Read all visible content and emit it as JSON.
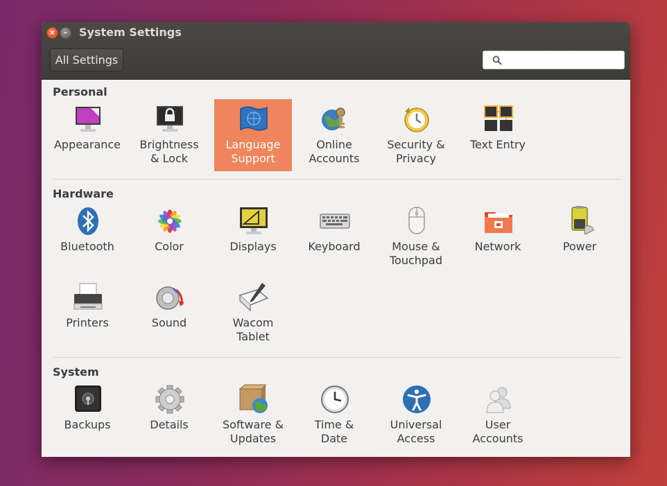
{
  "window": {
    "title": "System Settings"
  },
  "toolbar": {
    "all_settings_label": "All Settings",
    "search_placeholder": ""
  },
  "sections": [
    {
      "title": "Personal",
      "items": [
        {
          "label": "Appearance",
          "icon": "appearance-icon"
        },
        {
          "label": "Brightness\n& Lock",
          "icon": "lock-icon"
        },
        {
          "label": "Language\nSupport",
          "icon": "language-flag-icon",
          "selected": true
        },
        {
          "label": "Online\nAccounts",
          "icon": "online-accounts-icon"
        },
        {
          "label": "Security &\nPrivacy",
          "icon": "security-privacy-icon"
        },
        {
          "label": "Text Entry",
          "icon": "text-entry-icon"
        }
      ]
    },
    {
      "title": "Hardware",
      "items": [
        {
          "label": "Bluetooth",
          "icon": "bluetooth-icon"
        },
        {
          "label": "Color",
          "icon": "color-icon"
        },
        {
          "label": "Displays",
          "icon": "displays-icon"
        },
        {
          "label": "Keyboard",
          "icon": "keyboard-icon"
        },
        {
          "label": "Mouse &\nTouchpad",
          "icon": "mouse-icon"
        },
        {
          "label": "Network",
          "icon": "network-icon"
        },
        {
          "label": "Power",
          "icon": "power-icon"
        },
        {
          "label": "Printers",
          "icon": "printer-icon"
        },
        {
          "label": "Sound",
          "icon": "sound-icon"
        },
        {
          "label": "Wacom\nTablet",
          "icon": "wacom-tablet-icon"
        }
      ]
    },
    {
      "title": "System",
      "items": [
        {
          "label": "Backups",
          "icon": "backups-icon"
        },
        {
          "label": "Details",
          "icon": "details-gear-icon"
        },
        {
          "label": "Software &\nUpdates",
          "icon": "software-updates-icon"
        },
        {
          "label": "Time &\nDate",
          "icon": "clock-icon"
        },
        {
          "label": "Universal\nAccess",
          "icon": "universal-access-icon"
        },
        {
          "label": "User\nAccounts",
          "icon": "user-accounts-icon"
        }
      ]
    }
  ],
  "colors": {
    "selection": "#f0845c",
    "titlebar": "#3d3c38",
    "content_bg": "#f2f1f0"
  }
}
